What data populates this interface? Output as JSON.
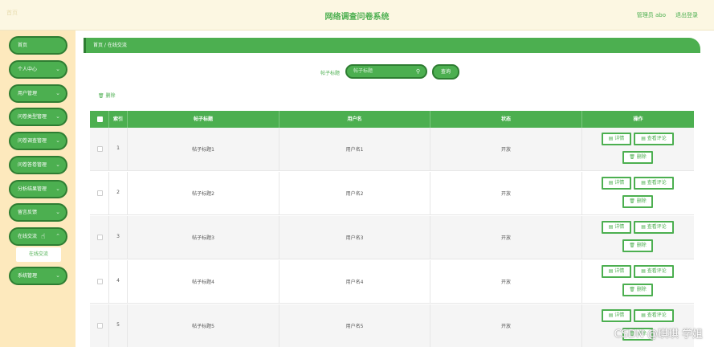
{
  "header": {
    "brand": "首页",
    "title": "网络调查问卷系统",
    "admin": "管理员 abo",
    "logout": "退出登录"
  },
  "sidebar": {
    "items": [
      {
        "label": "首页",
        "chev": ""
      },
      {
        "label": "个人中心",
        "chev": "⌄"
      },
      {
        "label": "用户管理",
        "chev": "⌄"
      },
      {
        "label": "问卷类型管理",
        "chev": "⌄"
      },
      {
        "label": "问卷调查管理",
        "chev": "⌄"
      },
      {
        "label": "问卷答卷管理",
        "chev": "⌄"
      },
      {
        "label": "分析结果管理",
        "chev": "⌄"
      },
      {
        "label": "留言反馈",
        "chev": "⌄"
      },
      {
        "label": "在线交流",
        "chev": "⌃"
      },
      {
        "label": "系统管理",
        "chev": "⌄"
      }
    ],
    "submenu": "在线交流"
  },
  "breadcrumb": "首页 / 在线交流",
  "search": {
    "label": "帖子标题",
    "placeholder": "帖子标题",
    "button": "查询"
  },
  "bulk_delete": "删除",
  "table": {
    "columns": [
      "索引",
      "帖子标题",
      "用户名",
      "状态",
      "操作"
    ],
    "rows": [
      {
        "index": "1",
        "title": "帖子标题1",
        "user": "用户名1",
        "status": "开放"
      },
      {
        "index": "2",
        "title": "帖子标题2",
        "user": "用户名2",
        "status": "开放"
      },
      {
        "index": "3",
        "title": "帖子标题3",
        "user": "用户名3",
        "status": "开放"
      },
      {
        "index": "4",
        "title": "帖子标题4",
        "user": "用户名4",
        "status": "开放"
      },
      {
        "index": "5",
        "title": "帖子标题5",
        "user": "用户名5",
        "status": "开放"
      }
    ],
    "actions": {
      "detail": "详情",
      "comments": "查看评论",
      "delete": "删除"
    }
  },
  "watermark": "CSDN @琪琪 学姐",
  "colors": {
    "accent": "#4caf50",
    "accent_dark": "#2e7d32",
    "sidebar_bg": "#fde9bd",
    "header_bg": "#fcf7e2"
  }
}
